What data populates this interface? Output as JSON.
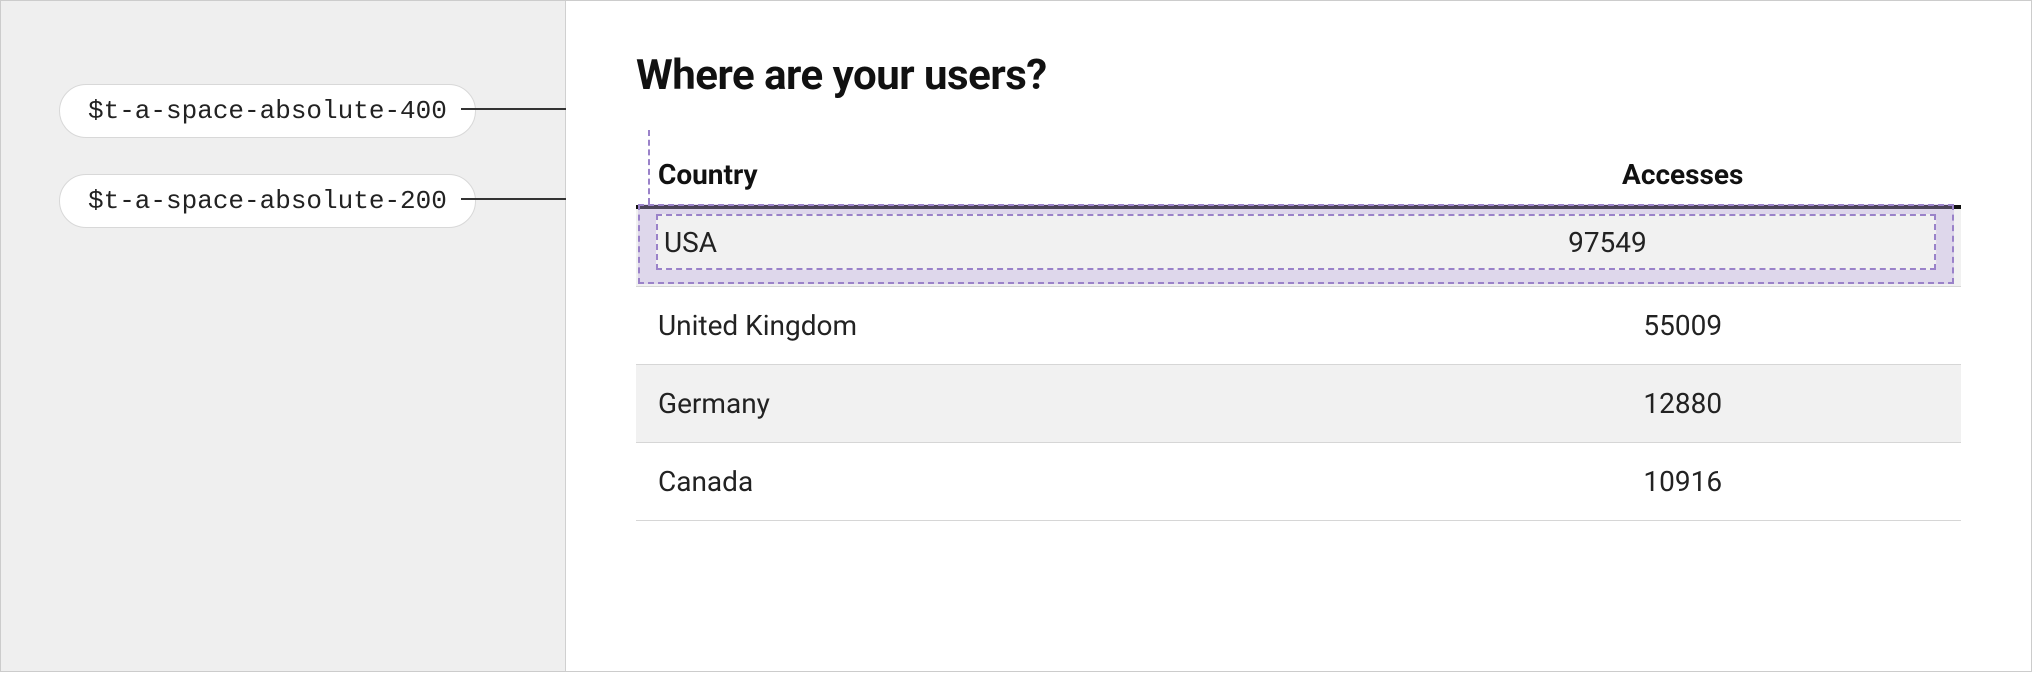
{
  "tokens": {
    "label1": "$t-a-space-absolute-400",
    "label2": "$t-a-space-absolute-200"
  },
  "main": {
    "heading": "Where are your users?"
  },
  "table": {
    "columns": {
      "country": "Country",
      "accesses": "Accesses"
    },
    "rows": [
      {
        "country": "USA",
        "accesses": "97549"
      },
      {
        "country": "United Kingdom",
        "accesses": "55009"
      },
      {
        "country": "Germany",
        "accesses": "12880"
      },
      {
        "country": "Canada",
        "accesses": "10916"
      }
    ]
  }
}
